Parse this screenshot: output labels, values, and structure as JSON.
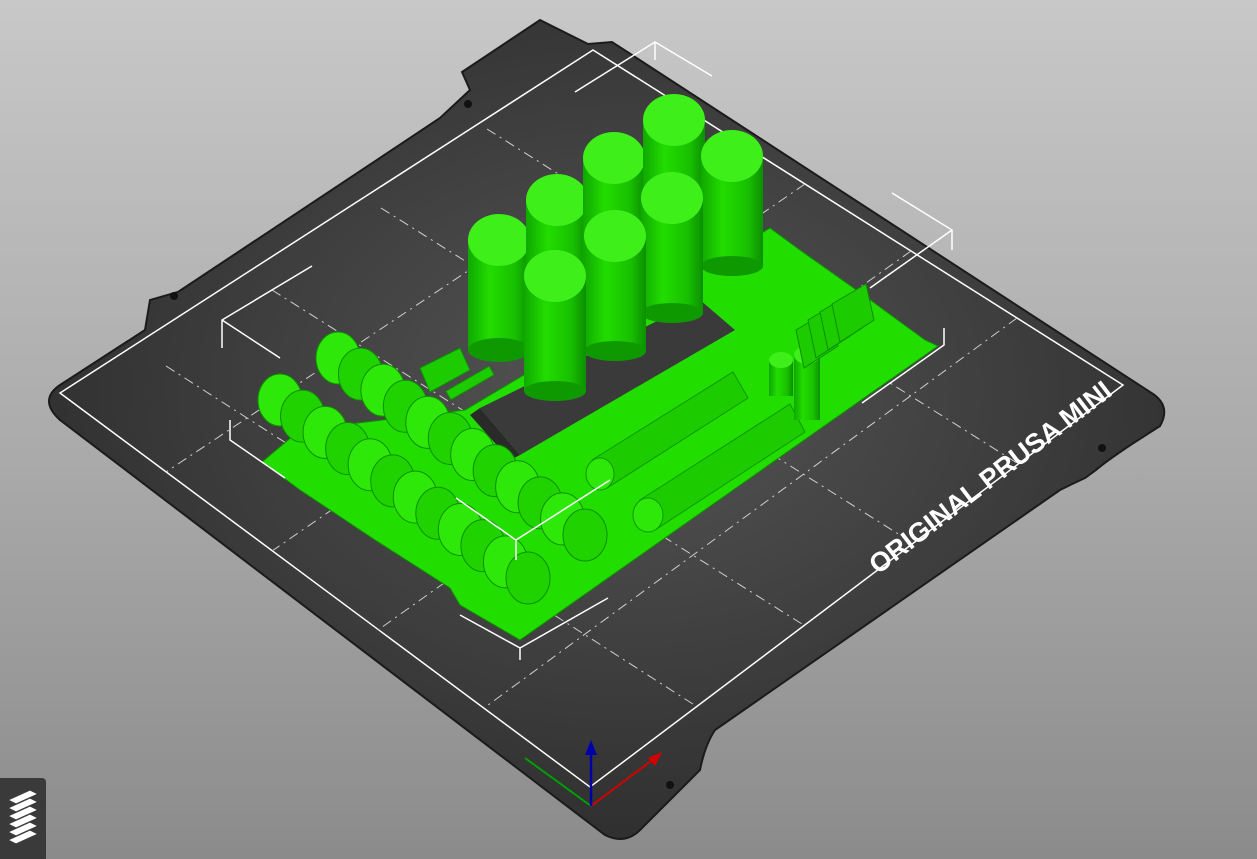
{
  "viewport": {
    "background_top": "#c8c8c8",
    "background_bottom": "#8b8b8b"
  },
  "bed": {
    "label": "ORIGINAL PRUSA MINI",
    "plate_color": "#2e2e2e",
    "grid_color": "#ffffff"
  },
  "model": {
    "color": "#22dd00",
    "selected": true
  },
  "axes": {
    "x_color": "#d40000",
    "y_color": "#00a000",
    "z_color": "#0000aa"
  },
  "toolbar": {
    "layers_icon": "layers-icon"
  }
}
